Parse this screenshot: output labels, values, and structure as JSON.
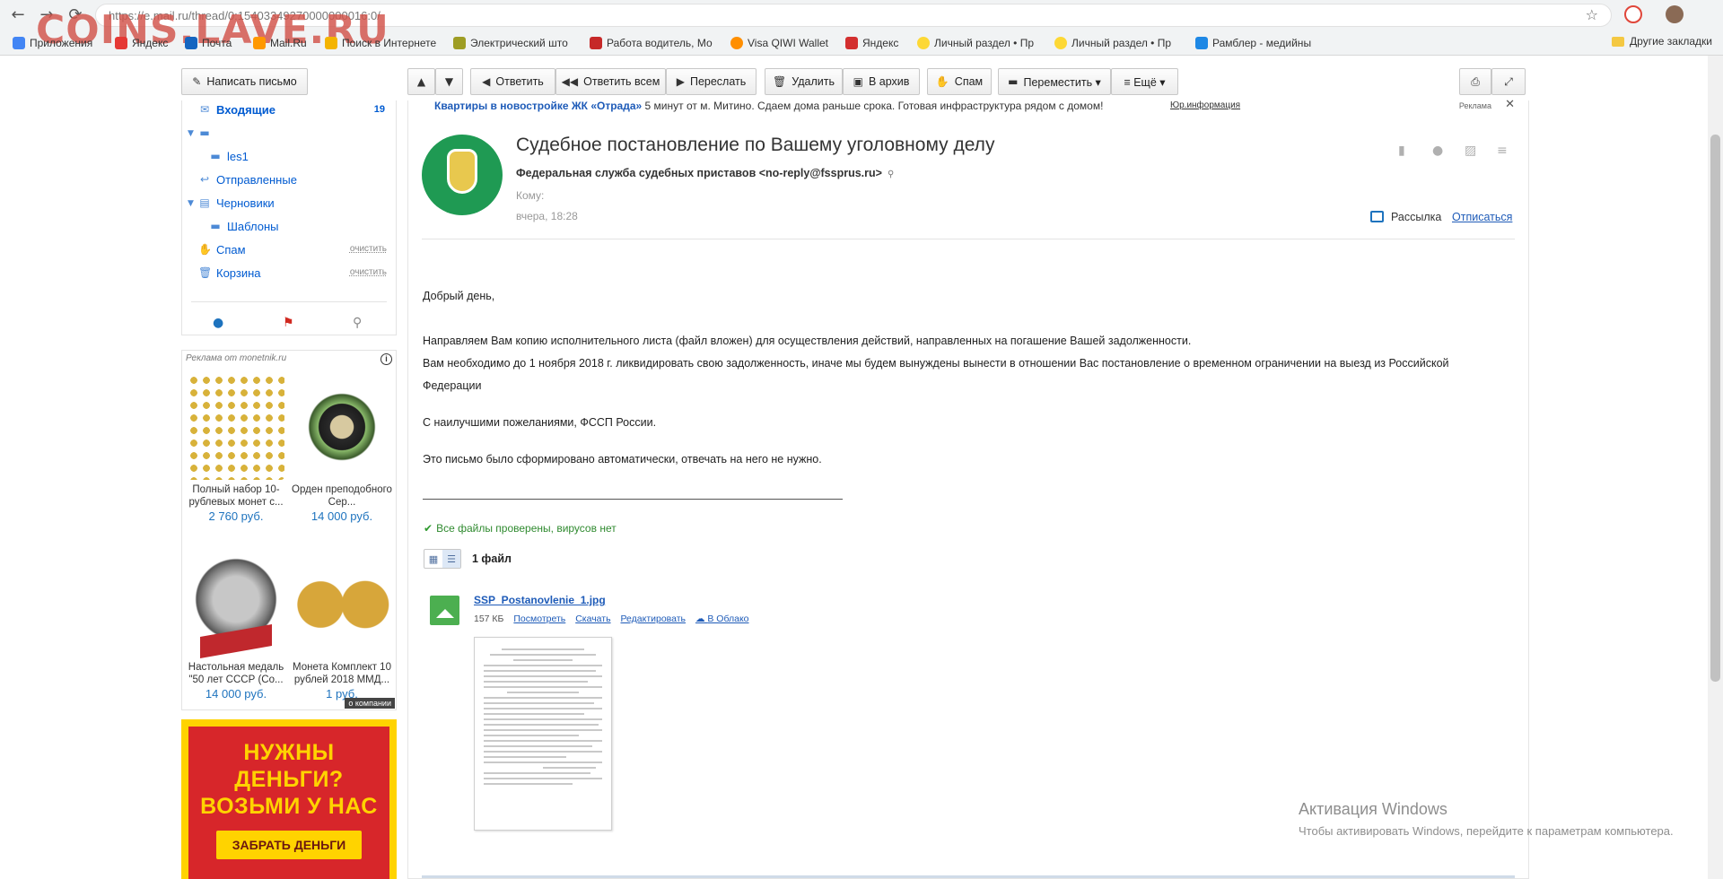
{
  "browser": {
    "url": "https://e.mail.ru/thread/0:15403349270000000016:0/",
    "back_icon": "arrow-left",
    "forward_icon": "arrow-right",
    "reload_icon": "reload",
    "star_icon": "star",
    "watermark": "COINS.LAVE.RU"
  },
  "bookmarks": {
    "items": [
      {
        "label": "Приложения",
        "color": "#4285f4"
      },
      {
        "label": "Яндекс",
        "color": "#e53935"
      },
      {
        "label": "Почта",
        "color": "#1565c0"
      },
      {
        "label": "Mail.Ru",
        "color": "#ff9800"
      },
      {
        "label": "Поиск в Интернете",
        "color": "#f4b400"
      },
      {
        "label": "Электрический што",
        "color": "#9e9d24"
      },
      {
        "label": "Работа водитель, Мо",
        "color": "#c62828"
      },
      {
        "label": "Visa QIWI Wallet",
        "color": "#ff8f00"
      },
      {
        "label": "Яндекс",
        "color": "#d32f2f"
      },
      {
        "label": "Личный раздел • Пр",
        "color": "#fdd835"
      },
      {
        "label": "Личный раздел • Пр",
        "color": "#fdd835"
      },
      {
        "label": "Рамблер - медийны",
        "color": "#1e88e5"
      }
    ],
    "other": "Другие закладки"
  },
  "toolbar": {
    "compose": "Написать письмо",
    "reply": "Ответить",
    "reply_all": "Ответить всем",
    "forward": "Переслать",
    "delete": "Удалить",
    "archive": "В архив",
    "spam": "Спам",
    "move": "Переместить ▾",
    "more": "≡ Ещё ▾"
  },
  "sidebar": {
    "inbox": "Входящие",
    "inbox_count": "19",
    "folder_les1": "les1",
    "sent": "Отправленные",
    "drafts": "Черновики",
    "templates": "Шаблоны",
    "spam": "Спам",
    "trash": "Корзина",
    "clear": "очистить"
  },
  "ads": {
    "label": "Реклама от monetnik.ru",
    "company": "о компании",
    "items": [
      {
        "name": "Полный набор 10-рублевых монет с...",
        "price": "2 760 руб."
      },
      {
        "name": "Орден преподобного Сер...",
        "price": "14 000 руб."
      },
      {
        "name": "Настольная медаль \"50 лет СССР (Со...",
        "price": "14 000 руб."
      },
      {
        "name": "Монета Комплект 10 рублей 2018 ММД...",
        "price": "1 руб."
      }
    ],
    "banner_title": "НУЖНЫ ДЕНЬГИ? ВОЗЬМИ У НАС",
    "banner_button": "ЗАБРАТЬ ДЕНЬГИ"
  },
  "adline": {
    "title": "Квартиры в новостройке ЖК «Отрада»",
    "text": "5 минут от м. Митино. Сдаем дома раньше срока. Готовая инфраструктура рядом с домом!",
    "info": "Юр.информация",
    "label": "Реклама"
  },
  "message": {
    "subject": "Судебное постановление по Вашему уголовному делу",
    "from": "Федеральная служба судебных приставов <no-reply@fssprus.ru>",
    "to": "Кому:",
    "date": "вчера, 18:28",
    "list_label": "Рассылка",
    "unsubscribe": "Отписаться",
    "body": {
      "greeting": "Добрый день,",
      "line1": "Направляем Вам копию исполнительного листа (файл вложен) для осуществления действий, направленных на погашение Вашей задолженности.",
      "line2": "Вам необходимо до 1 ноября 2018 г. ликвидировать свою задолженность, иначе мы будем вынуждены вынести в отношении Вас постановление о временном ограничении на выезд из Российской",
      "line3": "Федерации",
      "regards": "С наилучшими пожеланиями, ФССП России.",
      "auto": "Это письмо было сформировано автоматически, отвечать на него не нужно."
    }
  },
  "attachments": {
    "virus_check": "Все файлы проверены, вирусов нет",
    "count": "1 файл",
    "file_name": "SSP_Postanovlenie_1.jpg",
    "file_size": "157 КБ",
    "view": "Посмотреть",
    "download": "Скачать",
    "edit": "Редактировать",
    "cloud": "В Облако"
  },
  "windows": {
    "title": "Активация Windows",
    "text": "Чтобы активировать Windows, перейдите к параметрам компьютера."
  }
}
